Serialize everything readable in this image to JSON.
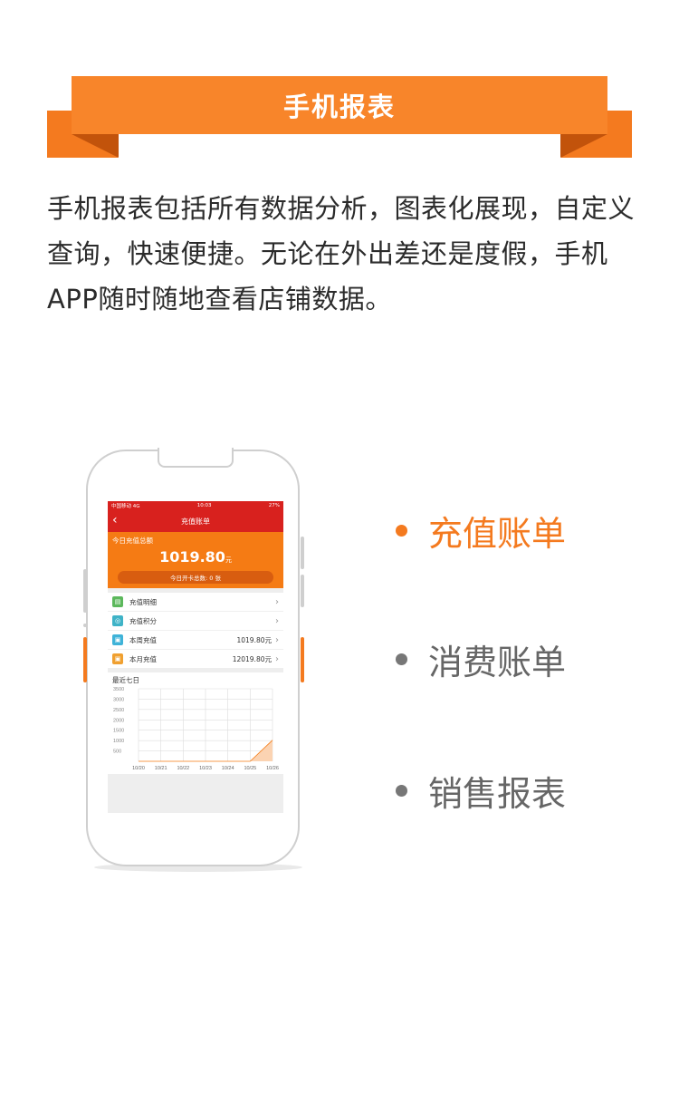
{
  "header": {
    "title": "手机报表"
  },
  "intro": {
    "lines": [
      "手机报表包括所有数据分析，图表化展现，自定义",
      "查询，快速便捷。无论在外出差还是度假，手机",
      "APP随时随地查看店铺数据。"
    ]
  },
  "phone": {
    "status": {
      "carrier": "中国移动  4G",
      "time": "10:03",
      "battery": "27%"
    },
    "nav": {
      "back": "‹",
      "title": "充值账单"
    },
    "summary": {
      "label": "今日充值总额",
      "amount": "1019.80",
      "unit": "元",
      "cards_text": "今日开卡总数: 0 张"
    },
    "menu": [
      {
        "label": "充值明细",
        "value": "",
        "icon": "list-icon",
        "color": "#5cb85c"
      },
      {
        "label": "充值积分",
        "value": "",
        "icon": "points-icon",
        "color": "#3fb3c7"
      },
      {
        "label": "本周充值",
        "value": "1019.80元",
        "icon": "calendar-week-icon",
        "color": "#3fb3d8"
      },
      {
        "label": "本月充值",
        "value": "12019.80元",
        "icon": "calendar-month-icon",
        "color": "#f0a030"
      }
    ],
    "chart_title": "最近七日"
  },
  "chart_data": {
    "type": "area",
    "title": "最近七日",
    "categories": [
      "10/20",
      "10/21",
      "10/22",
      "10/23",
      "10/24",
      "10/25",
      "10/26"
    ],
    "values": [
      0,
      0,
      0,
      0,
      0,
      0,
      1019.8
    ],
    "yticks": [
      500,
      1000,
      1500,
      2000,
      2500,
      3000,
      3500
    ],
    "ylim": [
      0,
      3500
    ],
    "grid": true,
    "color": "#f57b14"
  },
  "features": [
    {
      "label": "充值账单",
      "active": true
    },
    {
      "label": "消费账单",
      "active": false
    },
    {
      "label": "销售报表",
      "active": false
    }
  ],
  "colors": {
    "accent": "#f47a1f",
    "app_red": "#d8211e"
  }
}
